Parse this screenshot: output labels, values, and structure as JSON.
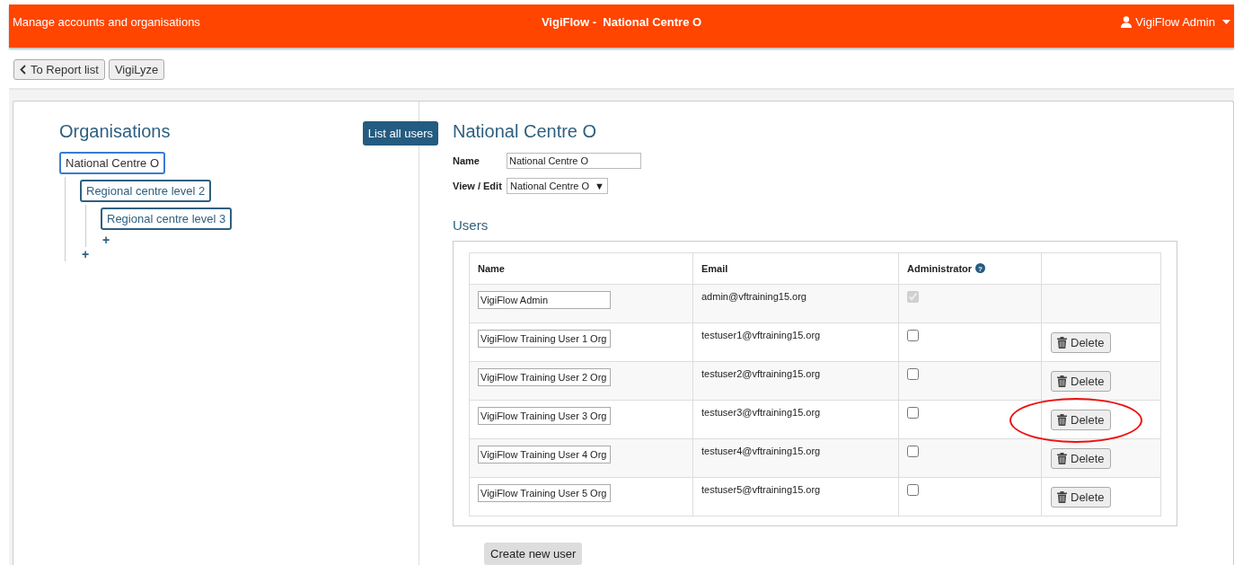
{
  "header": {
    "left": "Manage accounts and organisations",
    "title": "Vigi**Flow** -  National Centre O",
    "user": "VigiFlow Admin"
  },
  "toolbar": {
    "back": "To Report list",
    "vigilyze": "VigiLyze"
  },
  "organisations": {
    "heading": "Organisations",
    "list_all": "List all users",
    "tree": [
      {
        "label": "National Centre O",
        "selected": true,
        "add": "+",
        "children": [
          {
            "label": "Regional centre level 2",
            "selected": false,
            "add": "+",
            "children": [
              {
                "label": "Regional centre level 3",
                "selected": false
              }
            ]
          }
        ]
      }
    ]
  },
  "detail": {
    "heading": "National Centre O",
    "name_label": "Name",
    "name_value": "National Centre O",
    "view_label": "View / Edit",
    "view_value": "National Centre O",
    "view_caret": "▼",
    "users_heading": "Users"
  },
  "users": {
    "columns": [
      "Name",
      "Email",
      "Administrator"
    ],
    "help": "?",
    "rows": [
      {
        "name": "VigiFlow Admin",
        "email": "admin@vftraining15.org",
        "administrator": true,
        "disabled": true,
        "delete": null,
        "highlighted": false
      },
      {
        "name": "VigiFlow Training User 1 Org",
        "email": "testuser1@vftraining15.org",
        "administrator": false,
        "disabled": false,
        "delete": "Delete",
        "highlighted": false
      },
      {
        "name": "VigiFlow Training User 2 Org",
        "email": "testuser2@vftraining15.org",
        "administrator": false,
        "disabled": false,
        "delete": "Delete",
        "highlighted": false
      },
      {
        "name": "VigiFlow Training User 3 Org",
        "email": "testuser3@vftraining15.org",
        "administrator": false,
        "disabled": false,
        "delete": "Delete",
        "highlighted": true
      },
      {
        "name": "VigiFlow Training User 4 Org",
        "email": "testuser4@vftraining15.org",
        "administrator": false,
        "disabled": false,
        "delete": "Delete",
        "highlighted": false
      },
      {
        "name": "VigiFlow Training User 5 Org",
        "email": "testuser5@vftraining15.org",
        "administrator": false,
        "disabled": false,
        "delete": "Delete",
        "highlighted": false
      }
    ],
    "create": "Create new user"
  }
}
